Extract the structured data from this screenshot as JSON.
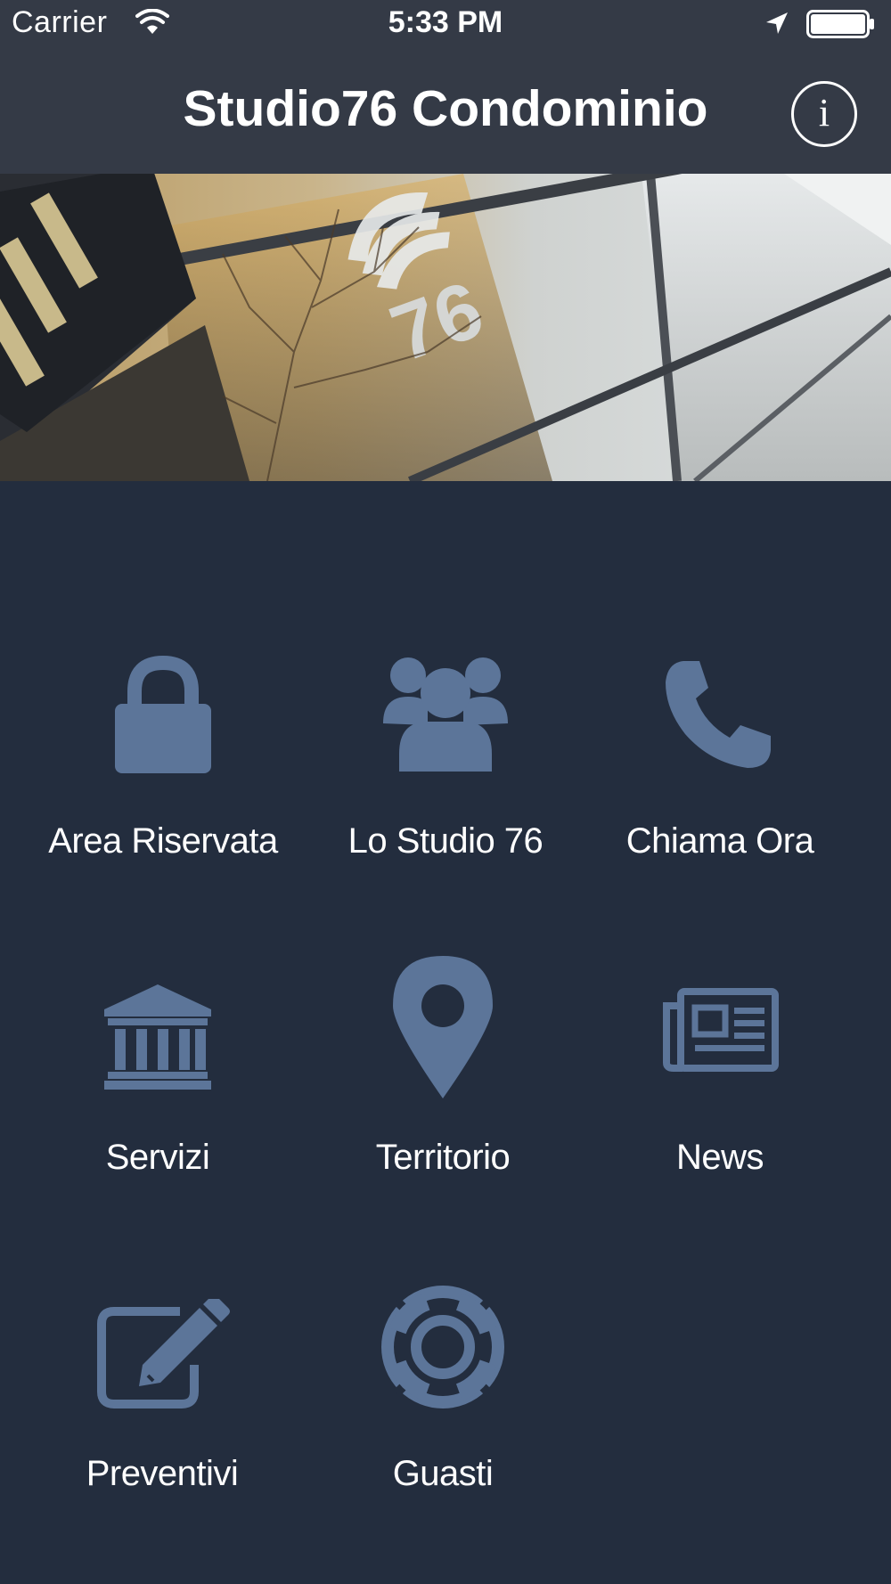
{
  "status_bar": {
    "carrier": "Carrier",
    "time": "5:33 PM",
    "icons": [
      "wifi-icon",
      "location-arrow-icon",
      "battery-icon"
    ]
  },
  "nav": {
    "title": "Studio76 Condominio",
    "info_label": "i",
    "info_icon": "info-circle-icon"
  },
  "hero": {
    "image": "building-glass-facade-photo"
  },
  "colors": {
    "top_bar": "#343a46",
    "background": "#232d3e",
    "icon": "#5c7599",
    "text": "#ffffff"
  },
  "menu": {
    "items": [
      {
        "label": "Area Riservata",
        "icon": "lock-icon"
      },
      {
        "label": "Lo Studio 76",
        "icon": "users-group-icon"
      },
      {
        "label": "Chiama Ora",
        "icon": "phone-icon"
      },
      {
        "label": "Servizi",
        "icon": "bank-icon"
      },
      {
        "label": "Territorio",
        "icon": "map-marker-icon"
      },
      {
        "label": "News",
        "icon": "newspaper-icon"
      },
      {
        "label": "Preventivi",
        "icon": "edit-pencil-icon"
      },
      {
        "label": "Guasti",
        "icon": "life-ring-icon"
      }
    ]
  }
}
